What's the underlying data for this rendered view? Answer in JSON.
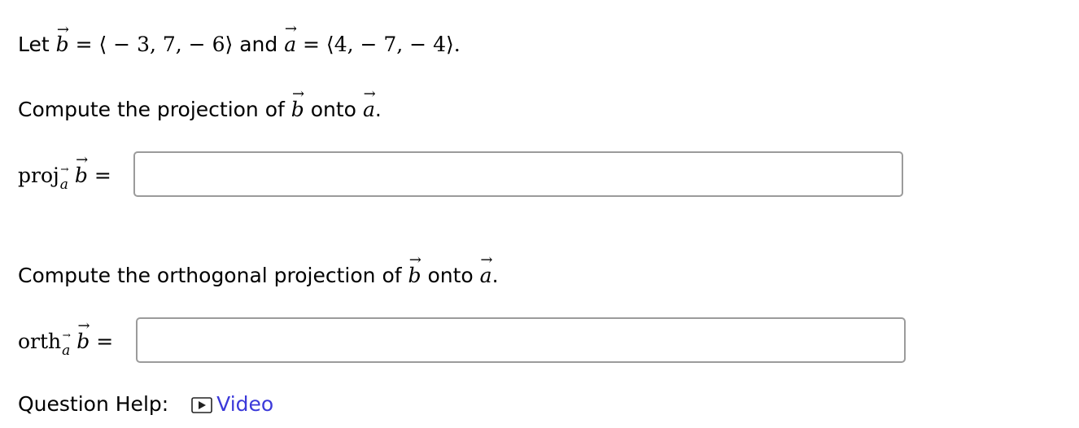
{
  "problem": {
    "statement": {
      "let": "Let",
      "b_name": "b",
      "eq1": " = ⟨ − 3, 7,  − 6⟩ ",
      "and": "and",
      "a_name": "a",
      "eq2": " = ⟨4,  − 7,  − 4⟩."
    },
    "part1": {
      "prompt_before": "Compute the projection of ",
      "b_name": "b",
      "prompt_middle": " onto ",
      "a_name": "a",
      "prompt_end": ".",
      "lhs_name": "proj",
      "lhs_sub": "a",
      "lhs_vec": "b",
      "equals": " =",
      "answer_value": ""
    },
    "part2": {
      "prompt_before": "Compute the orthogonal projection of ",
      "b_name": "b",
      "prompt_middle": " onto ",
      "a_name": "a",
      "prompt_end": ".",
      "lhs_name": "orth",
      "lhs_sub": "a",
      "lhs_vec": "b",
      "equals": " =",
      "answer_value": ""
    }
  },
  "help": {
    "label": "Question Help:",
    "video_label": "Video",
    "video_icon": "play-video-icon",
    "link_color": "#3b39d9"
  }
}
